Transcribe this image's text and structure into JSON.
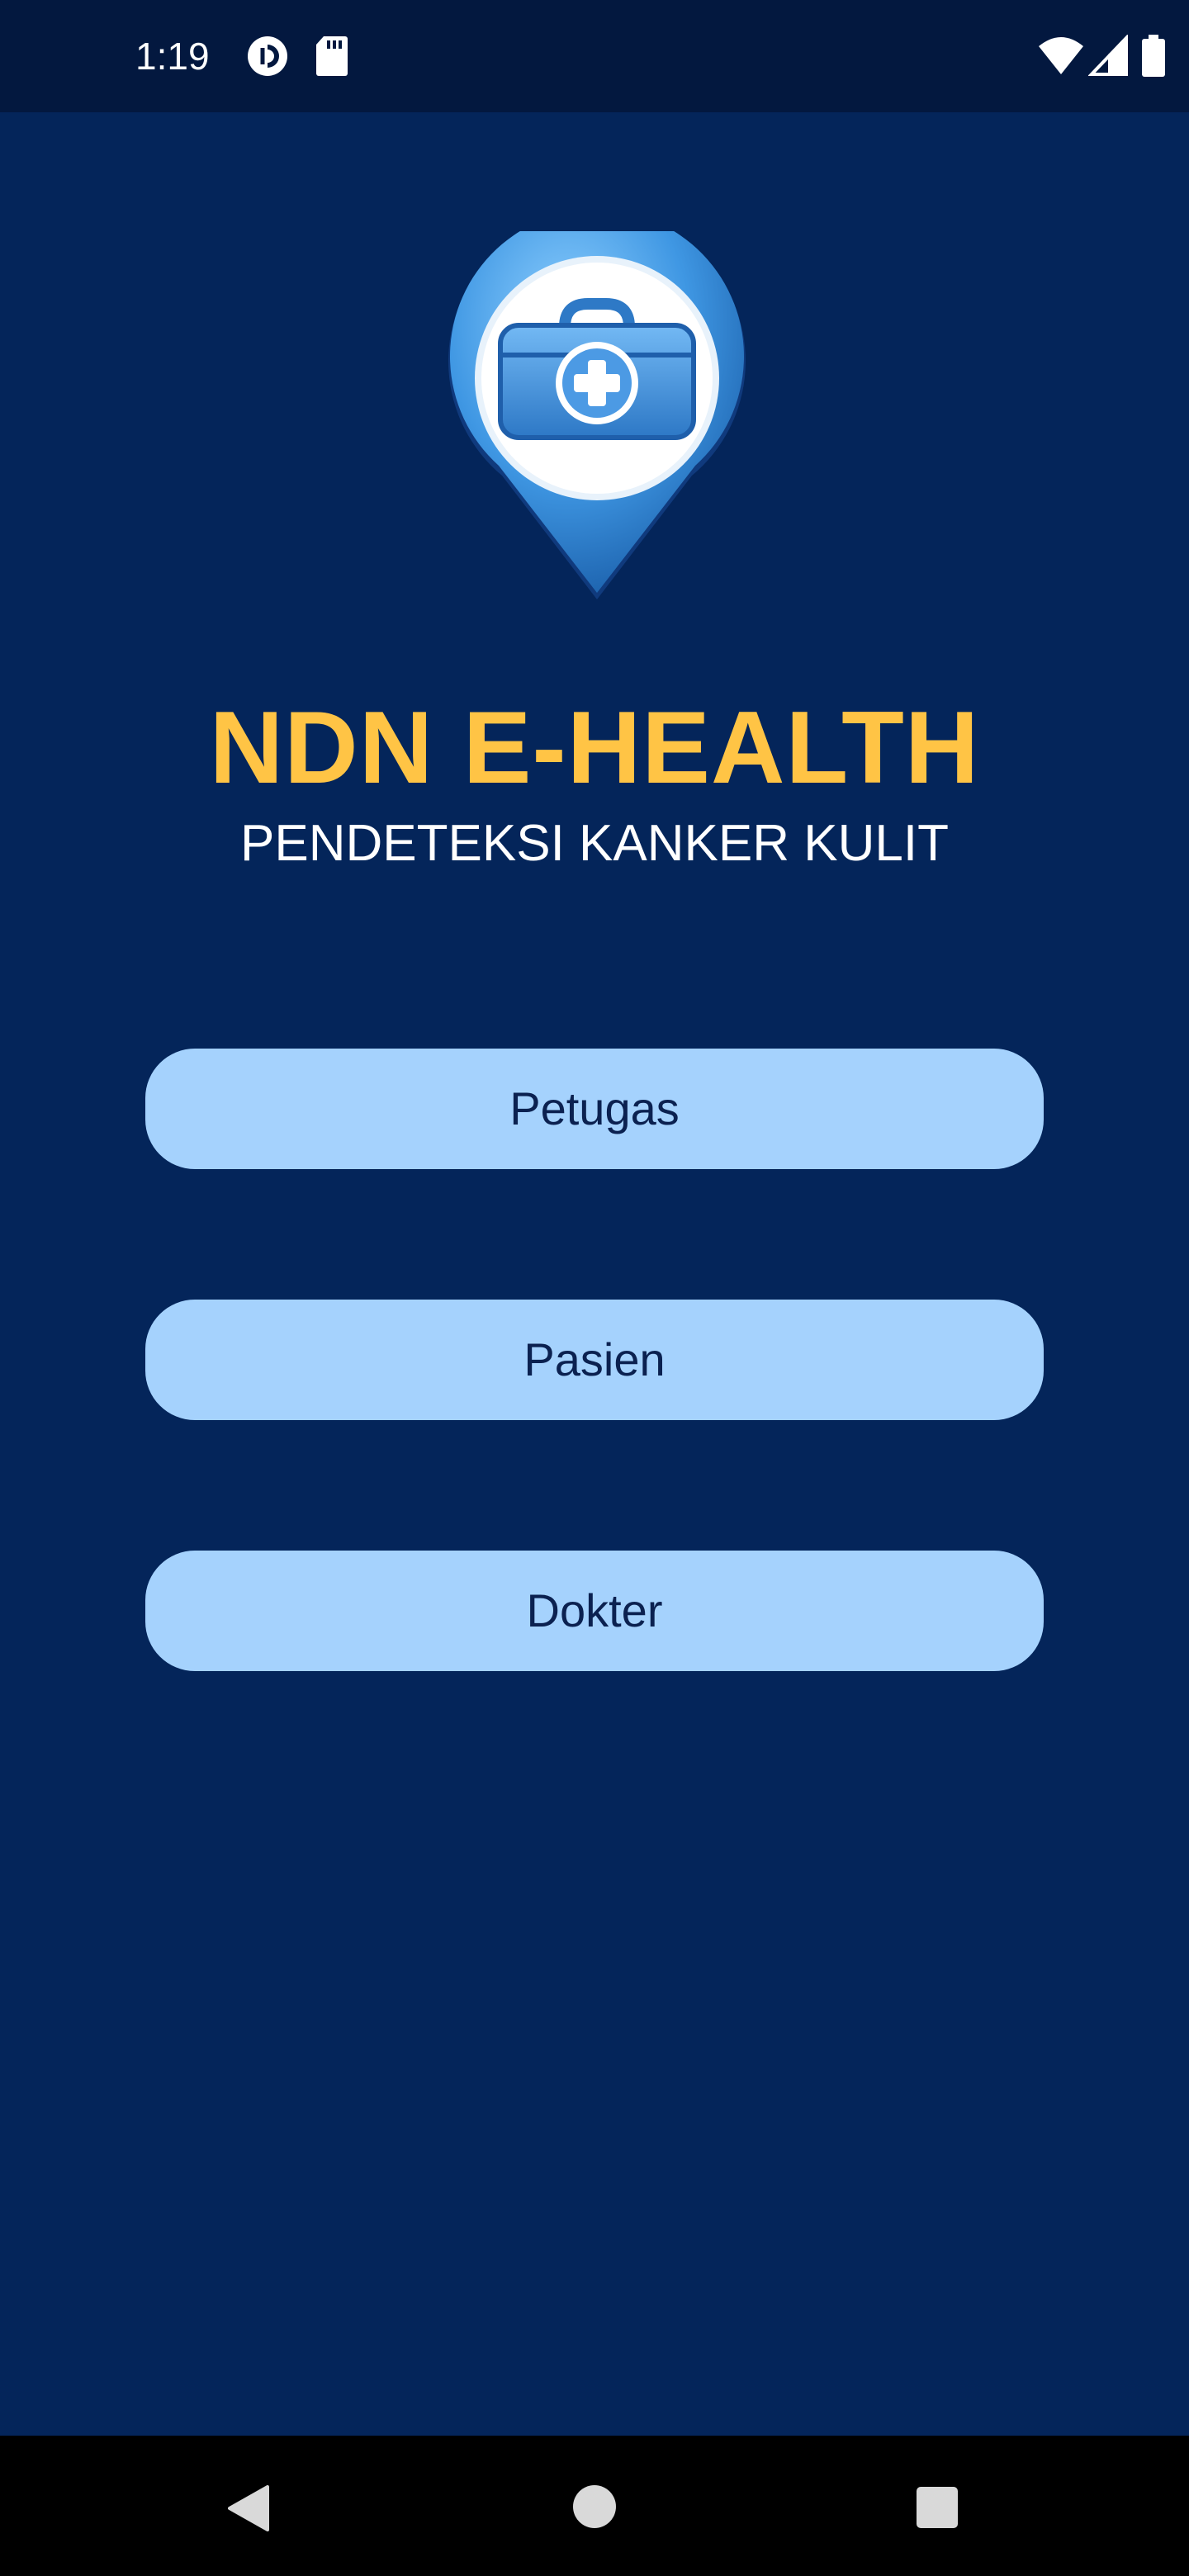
{
  "status_bar": {
    "time": "1:19",
    "icons": [
      "pocket-casts-icon",
      "sd-card-icon",
      "wifi-icon",
      "cellular-signal-icon",
      "battery-icon"
    ]
  },
  "app": {
    "logo_icon": "medical-kit-location-pin-icon",
    "title": "NDN E-HEALTH",
    "subtitle": "PENDETEKSI KANKER KULIT",
    "buttons": [
      {
        "label": "Petugas"
      },
      {
        "label": "Pasien"
      },
      {
        "label": "Dokter"
      }
    ]
  },
  "nav_bar": {
    "icons": [
      "back-icon",
      "home-icon",
      "recents-icon"
    ]
  },
  "colors": {
    "background": "#04255a",
    "status_bar": "#03183f",
    "title": "#ffc445",
    "button": "#a5d2fd",
    "button_text": "#0b2150"
  }
}
